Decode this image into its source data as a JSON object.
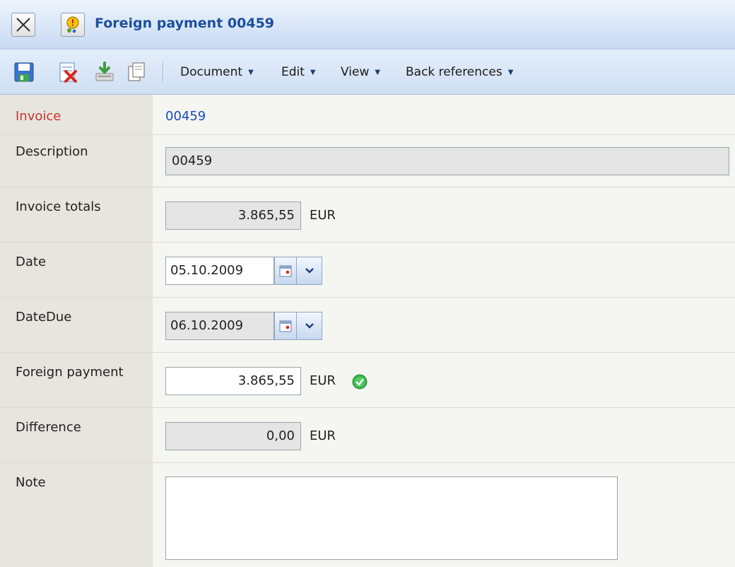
{
  "window": {
    "title": "Foreign payment 00459",
    "close_icon": "close-x-icon",
    "doc_icon": "payment-document-icon"
  },
  "toolbar": {
    "icons": [
      "save-icon",
      "delete-icon",
      "export-icon",
      "copy-icon"
    ],
    "menus": {
      "document": "Document",
      "edit": "Edit",
      "view": "View",
      "back_references": "Back references"
    },
    "menu_arrow": "▼"
  },
  "form": {
    "invoice": {
      "label": "Invoice",
      "value": "00459"
    },
    "description": {
      "label": "Description",
      "value": "00459"
    },
    "invoice_totals": {
      "label": "Invoice totals",
      "value": "3.865,55",
      "currency": "EUR"
    },
    "date": {
      "label": "Date",
      "value": "05.10.2009"
    },
    "date_due": {
      "label": "DateDue",
      "value": "06.10.2009"
    },
    "foreign_payment": {
      "label": "Foreign payment",
      "value": "3.865,55",
      "currency": "EUR",
      "status_icon": "check-ok-icon"
    },
    "difference": {
      "label": "Difference",
      "value": "0,00",
      "currency": "EUR"
    },
    "note": {
      "label": "Note",
      "value": ""
    }
  },
  "colors": {
    "invoice_label": "#c8332e",
    "link": "#1b4cc0",
    "title": "#1d4f9c",
    "ok_green": "#3bb54a"
  }
}
